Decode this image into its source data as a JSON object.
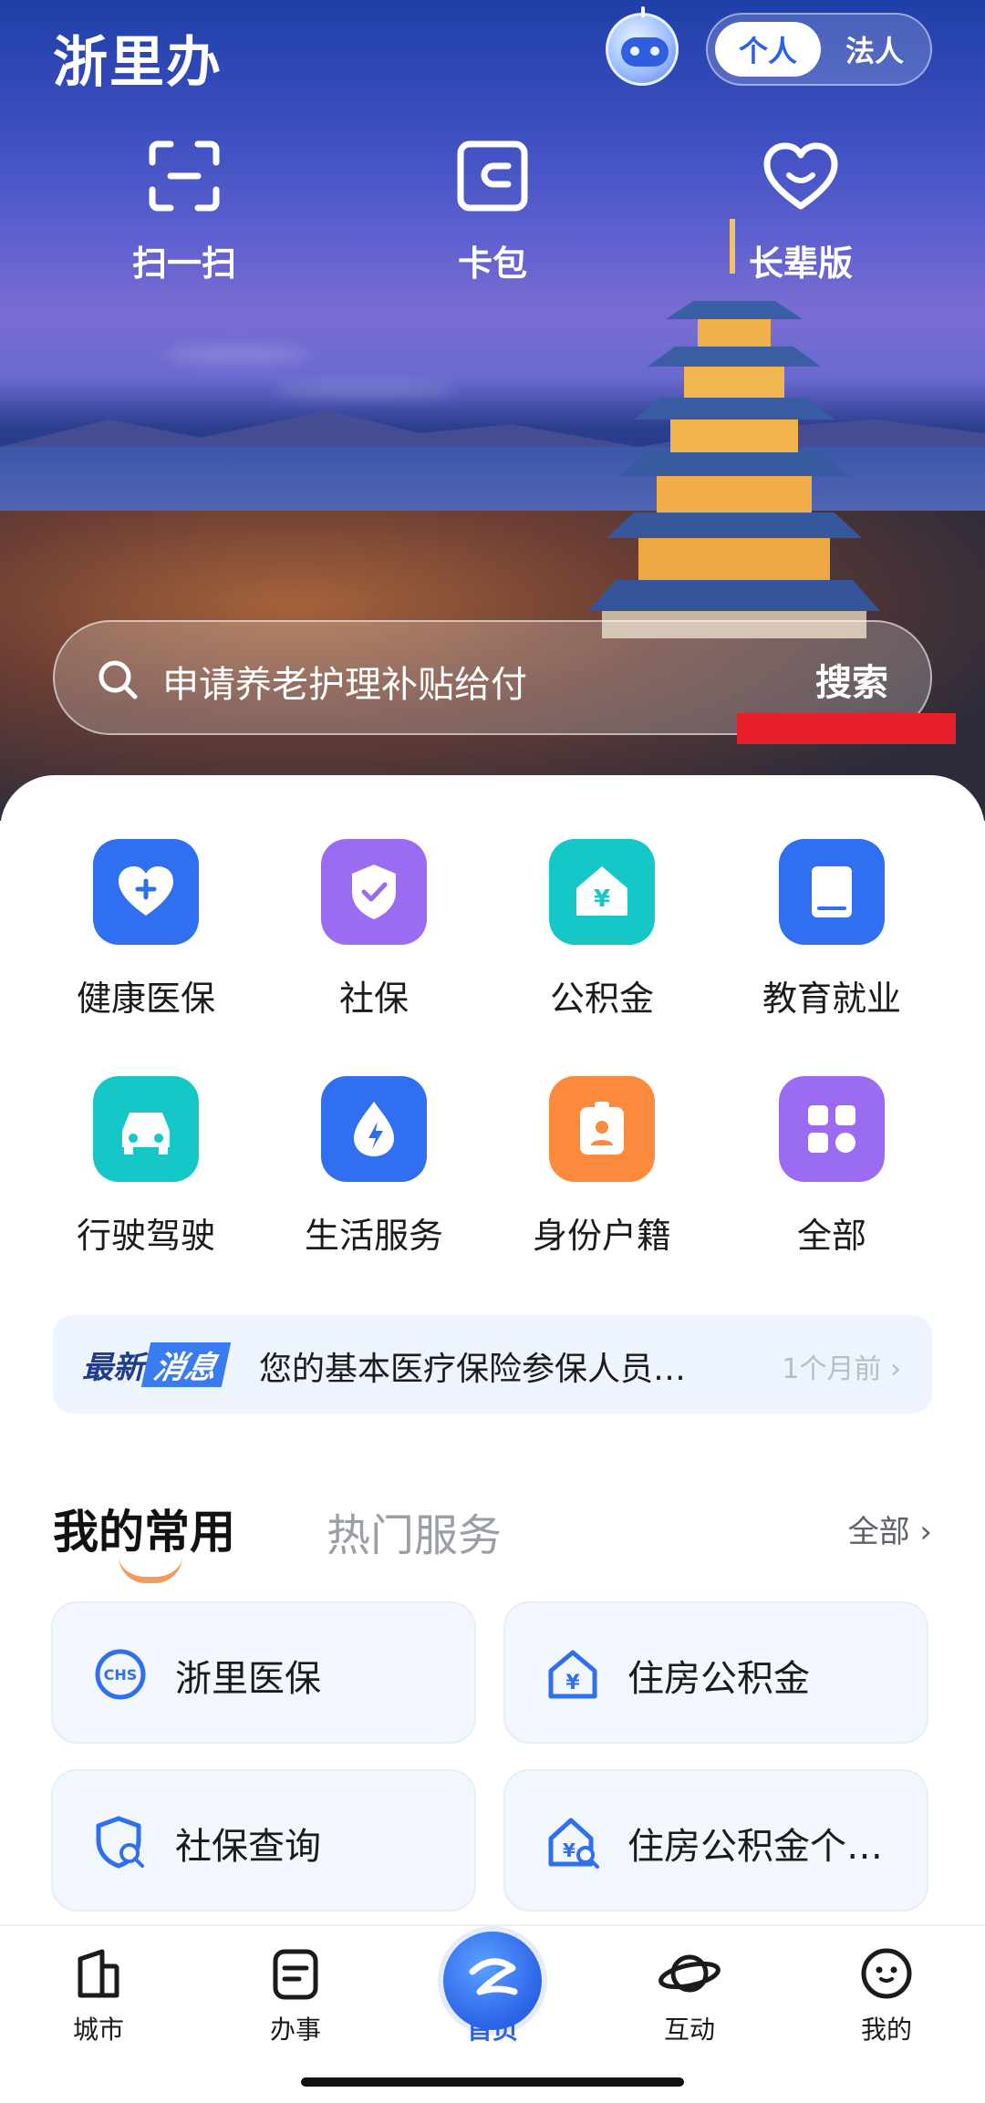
{
  "app": {
    "title": "浙里办"
  },
  "identity_toggle": {
    "personal": "个人",
    "legal": "法人"
  },
  "quick_actions": [
    {
      "label": "扫一扫",
      "icon": "scan-icon"
    },
    {
      "label": "卡包",
      "icon": "wallet-icon"
    },
    {
      "label": "长辈版",
      "icon": "heart-smile-icon"
    }
  ],
  "search": {
    "placeholder": "申请养老护理补贴给付",
    "button": "搜索"
  },
  "services_grid": [
    {
      "label": "健康医保",
      "icon": "heart-plus-icon",
      "color": "#2f6ff0"
    },
    {
      "label": "社保",
      "icon": "shield-check-icon",
      "color": "#9b6cf1"
    },
    {
      "label": "公积金",
      "icon": "house-yen-icon",
      "color": "#16c7c8"
    },
    {
      "label": "教育就业",
      "icon": "book-icon",
      "color": "#2f6ff0"
    },
    {
      "label": "行驶驾驶",
      "icon": "car-icon",
      "color": "#16c7c8"
    },
    {
      "label": "生活服务",
      "icon": "water-bolt-icon",
      "color": "#2f6ff0"
    },
    {
      "label": "身份户籍",
      "icon": "id-badge-icon",
      "color": "#fb8a3c"
    },
    {
      "label": "全部",
      "icon": "apps-grid-icon",
      "color": "#9b6cf1"
    }
  ],
  "news": {
    "badge_a": "最新",
    "badge_b": "消息",
    "text": "您的基本医疗保险参保人员…",
    "time": "1个月前 ›"
  },
  "section_tabs": {
    "active": "我的常用",
    "inactive": "热门服务",
    "all": "全部 ›"
  },
  "my_services": [
    {
      "label": "浙里医保",
      "icon": "chs-icon"
    },
    {
      "label": "住房公积金",
      "icon": "house-yen-outline-icon"
    },
    {
      "label": "社保查询",
      "icon": "shield-search-icon"
    },
    {
      "label": "住房公积金个…",
      "icon": "house-yen-search-icon"
    }
  ],
  "tabbar": [
    {
      "label": "城市",
      "icon": "city-icon"
    },
    {
      "label": "办事",
      "icon": "task-icon"
    },
    {
      "label": "首页",
      "icon": "home-logo-icon",
      "active": true
    },
    {
      "label": "互动",
      "icon": "planet-icon"
    },
    {
      "label": "我的",
      "icon": "profile-face-icon"
    }
  ]
}
